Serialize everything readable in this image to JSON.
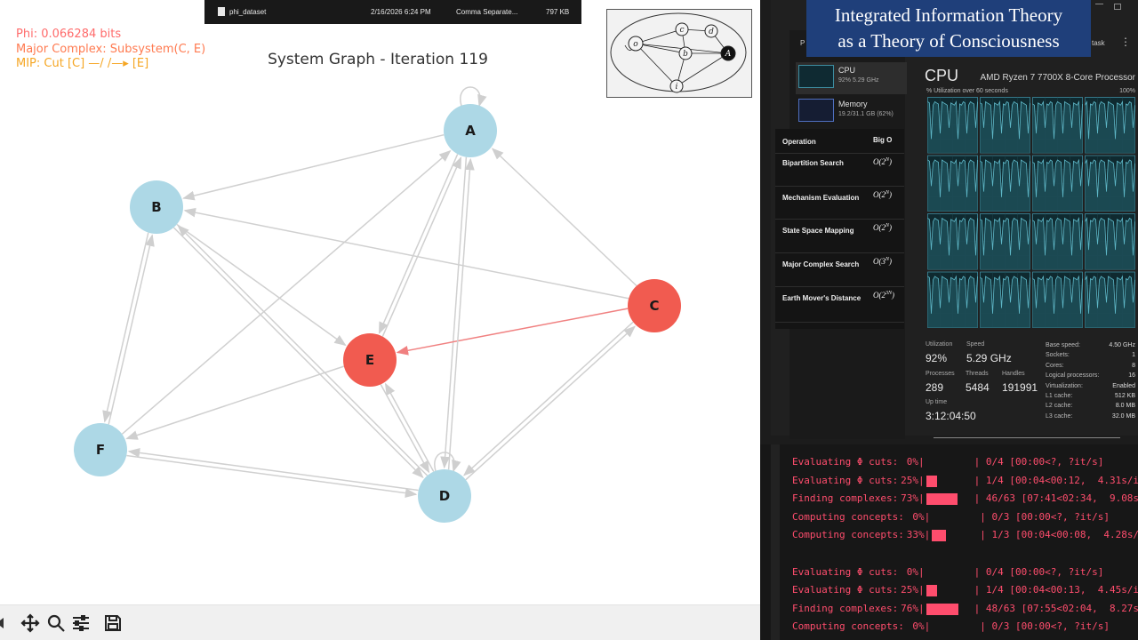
{
  "plot": {
    "phi_text": "Phi: 0.066284 bits",
    "complex_text": "Major Complex: Subsystem(C, E)",
    "mip_text": "MIP: Cut [C] —/ /—▸ [E]",
    "title": "System Graph - Iteration 119",
    "nodes": [
      {
        "id": "A",
        "active": false
      },
      {
        "id": "B",
        "active": false
      },
      {
        "id": "C",
        "active": true
      },
      {
        "id": "D",
        "active": false
      },
      {
        "id": "E",
        "active": true
      },
      {
        "id": "F",
        "active": false
      }
    ],
    "edges": [
      [
        "A",
        "A"
      ],
      [
        "A",
        "B"
      ],
      [
        "A",
        "E"
      ],
      [
        "A",
        "D"
      ],
      [
        "B",
        "E"
      ],
      [
        "B",
        "F"
      ],
      [
        "B",
        "D"
      ],
      [
        "C",
        "A"
      ],
      [
        "C",
        "B"
      ],
      [
        "C",
        "E"
      ],
      [
        "C",
        "D"
      ],
      [
        "D",
        "A"
      ],
      [
        "D",
        "B"
      ],
      [
        "D",
        "E"
      ],
      [
        "D",
        "C"
      ],
      [
        "D",
        "F"
      ],
      [
        "D",
        "D"
      ],
      [
        "E",
        "A"
      ],
      [
        "E",
        "D"
      ],
      [
        "E",
        "F"
      ],
      [
        "F",
        "B"
      ],
      [
        "F",
        "A"
      ],
      [
        "F",
        "D"
      ]
    ],
    "highlight_edge": [
      "C",
      "E"
    ],
    "colors": {
      "inactive": "#add8e6",
      "active": "#f15b50",
      "edge": "#d0d0d0",
      "highlight": "#f08080"
    }
  },
  "toolbar": {
    "icons": [
      "back-arrow-icon",
      "pan-icon",
      "zoom-icon",
      "configure-subplots-icon",
      "save-icon"
    ]
  },
  "file_row": {
    "name": "phi_dataset",
    "date": "2/16/2026 6:24 PM",
    "type": "Comma Separate...",
    "size": "797 KB"
  },
  "diagram": {
    "nodes": [
      "o",
      "c",
      "d",
      "b",
      "A",
      "i"
    ]
  },
  "banner": {
    "line1": "Integrated Information Theory",
    "line2": "as a Theory of Consciousness"
  },
  "task_manager": {
    "side": {
      "cpu_label": "CPU",
      "cpu_detail": "92%  5.29 GHz",
      "mem_label": "Memory",
      "mem_detail": "19.2/31.1 GB (62%)"
    },
    "cpu_title": "CPU",
    "cpu_model": "AMD Ryzen 7 7700X 8-Core Processor",
    "util_label": "% Utilization over 60 seconds",
    "util_max": "100%",
    "stats": {
      "utilization_label": "Utilization",
      "utilization": "92%",
      "speed_label": "Speed",
      "speed": "5.29 GHz",
      "processes_label": "Processes",
      "processes": "289",
      "threads_label": "Threads",
      "threads": "5484",
      "handles_label": "Handles",
      "handles": "191991",
      "uptime_label": "Up time",
      "uptime": "3:12:04:50"
    },
    "specs": [
      {
        "k": "Base speed:",
        "v": "4.50 GHz"
      },
      {
        "k": "Sockets:",
        "v": "1"
      },
      {
        "k": "Cores:",
        "v": "8"
      },
      {
        "k": "Logical processors:",
        "v": "16"
      },
      {
        "k": "Virtualization:",
        "v": "Enabled"
      },
      {
        "k": "L1 cache:",
        "v": "512 KB"
      },
      {
        "k": "L2 cache:",
        "v": "8.0 MB"
      },
      {
        "k": "L3 cache:",
        "v": "32.0 MB"
      }
    ],
    "core_count": 16,
    "header_stub_1": "P",
    "header_stub_2": "task"
  },
  "complexity": {
    "header_op": "Operation",
    "header_big": "Big O",
    "rows": [
      {
        "op": "Bipartition Search",
        "big": "O(2^N)"
      },
      {
        "op": "Mechanism Evaluation",
        "big": "O(2^N)"
      },
      {
        "op": "State Space Mapping",
        "big": "O(2^N)"
      },
      {
        "op": "Major Complex Search",
        "big": "O(3^N)"
      },
      {
        "op": "Earth Mover's Distance",
        "big": "O(2^3N)"
      }
    ]
  },
  "terminal": {
    "lines": [
      {
        "label": "Evaluating Φ cuts:",
        "pct": "0%",
        "fill": 0.0,
        "stats": "| 0/4 [00:00<?, ?it/s]"
      },
      {
        "label": "Evaluating Φ cuts:",
        "pct": "25%",
        "fill": 0.25,
        "stats": "| 1/4 [00:04<00:12,  4.31s/it]"
      },
      {
        "label": "Finding complexes:",
        "pct": "73%",
        "fill": 0.73,
        "stats": "| 46/63 [07:41<02:34,  9.08s/it]"
      },
      {
        "label": "Computing concepts:",
        "pct": "0%",
        "fill": 0.0,
        "stats": "| 0/3 [00:00<?, ?it/s]"
      },
      {
        "label": "Computing concepts:",
        "pct": "33%",
        "fill": 0.33,
        "stats": "| 1/3 [00:04<00:08,  4.28s/it]"
      },
      {
        "label": "",
        "pct": "",
        "fill": 0.0,
        "stats": ""
      },
      {
        "label": "Evaluating Φ cuts:",
        "pct": "0%",
        "fill": 0.0,
        "stats": "| 0/4 [00:00<?, ?it/s]"
      },
      {
        "label": "Evaluating Φ cuts:",
        "pct": "25%",
        "fill": 0.25,
        "stats": "| 1/4 [00:04<00:13,  4.45s/it]"
      },
      {
        "label": "Finding complexes:",
        "pct": "76%",
        "fill": 0.76,
        "stats": "| 48/63 [07:55<02:04,  8.27s/it]"
      },
      {
        "label": "Computing concepts:",
        "pct": "0%",
        "fill": 0.0,
        "stats": "| 0/3 [00:00<?, ?it/s]"
      }
    ]
  }
}
